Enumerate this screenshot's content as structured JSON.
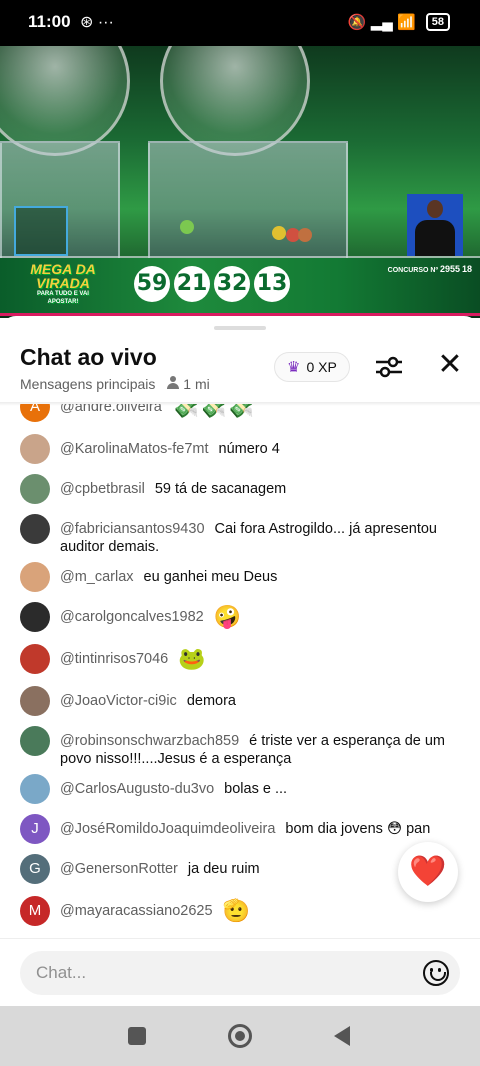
{
  "status_bar": {
    "time": "11:00",
    "left_icons": "⊛ ···",
    "right_icons": "🔕 ▂▄ 📶",
    "battery": "58"
  },
  "video": {
    "logo_title": "MEGA DA VIRADA",
    "logo_sub": "PARA TUDO E VAI APOSTAR!",
    "drawn_numbers": [
      "59",
      "21",
      "32",
      "13"
    ],
    "concurso_label": "CONCURSO Nº",
    "concurso_number": "2955",
    "rating": "18"
  },
  "chat": {
    "title": "Chat ao vivo",
    "mode": "Mensagens principais",
    "viewers": "1 mi",
    "xp": "0 XP",
    "input_placeholder": "Chat...",
    "messages": [
      {
        "author": "@andre.oliveira",
        "text": "💸💸💸",
        "avatar": "A",
        "avatar_color": "#e8710a"
      },
      {
        "author": "@KarolinaMatos-fe7mt",
        "text": "número 4",
        "avatar": "",
        "avatar_color": "#c9a48a"
      },
      {
        "author": "@cpbetbrasil",
        "text": "59 tá de sacanagem",
        "avatar": "",
        "avatar_color": "#6b8f6e"
      },
      {
        "author": "@fabriciansantos9430",
        "text": "Cai fora Astrogildo... já apresentou auditor demais.",
        "avatar": "",
        "avatar_color": "#3a3a3a"
      },
      {
        "author": "@m_carlax",
        "text": "eu ganhei meu Deus",
        "avatar": "",
        "avatar_color": "#d9a37a"
      },
      {
        "author": "@carolgoncalves1982",
        "text": "🤪",
        "avatar": "",
        "avatar_color": "#2b2b2b"
      },
      {
        "author": "@tintinrisos7046",
        "text": "🐸",
        "avatar": "",
        "avatar_color": "#c0392b"
      },
      {
        "author": "@JoaoVictor-ci9ic",
        "text": "demora",
        "avatar": "",
        "avatar_color": "#8a7060"
      },
      {
        "author": "@robinsonschwarzbach859",
        "text": "é triste ver a esperança de um povo nisso!!!....Jesus é a esperança",
        "avatar": "",
        "avatar_color": "#4a7a5a"
      },
      {
        "author": "@CarlosAugusto-du3vo",
        "text": "bolas e ...",
        "avatar": "",
        "avatar_color": "#7aa8c8"
      },
      {
        "author": "@JoséRomildoJoaquimdeoliveira",
        "text": "bom dia jovens 😳 pan",
        "avatar": "J",
        "avatar_color": "#7e57c2"
      },
      {
        "author": "@GenersonRotter",
        "text": "ja deu ruim",
        "avatar": "G",
        "avatar_color": "#546e7a"
      },
      {
        "author": "@mayaracassiano2625",
        "text": "🫡",
        "avatar": "M",
        "avatar_color": "#c62828"
      }
    ]
  },
  "reaction": "❤️"
}
